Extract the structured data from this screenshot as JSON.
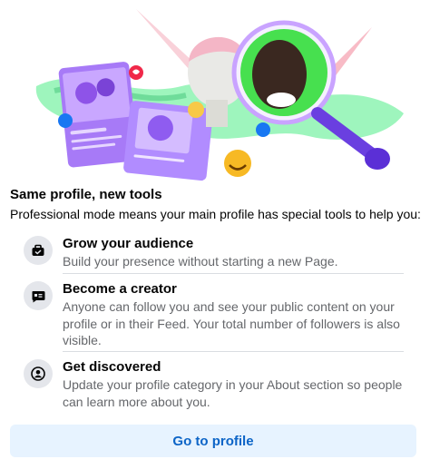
{
  "dialog": {
    "heading": "Same profile, new tools",
    "subtext": "Professional mode means your main profile has special tools to help you:",
    "features": [
      {
        "title": "Grow your audience",
        "description": "Build your presence without starting a new Page.",
        "icon": "briefcase-icon"
      },
      {
        "title": "Become a creator",
        "description": "Anyone can follow you and see your public content on your profile or in their Feed. Your total number of followers is also visible.",
        "icon": "message-icon"
      },
      {
        "title": "Get discovered",
        "description": "Update your profile category in your About section so people can learn more about you.",
        "icon": "profile-icon"
      }
    ],
    "button_label": "Go to profile"
  },
  "colors": {
    "accent": "#0c64c7",
    "button_bg": "#e7f3ff",
    "icon_bg": "#e4e6eb",
    "secondary_text": "#65676b"
  }
}
